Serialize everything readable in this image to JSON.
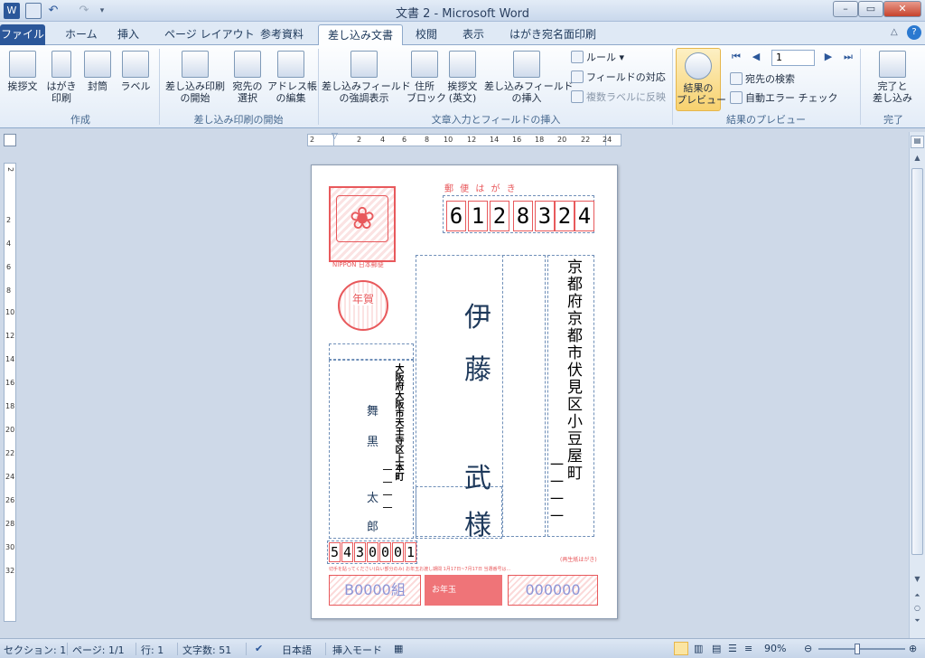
{
  "window": {
    "title": "文書 2 - Microsoft Word"
  },
  "tabs": [
    "ファイル",
    "ホーム",
    "挿入",
    "ページ レイアウト",
    "参考資料",
    "差し込み文書",
    "校閲",
    "表示",
    "はがき宛名面印刷"
  ],
  "ribbon": {
    "create": {
      "buttons": [
        "挨拶文",
        "はがき\n印刷",
        "封筒",
        "ラベル"
      ],
      "label": "作成"
    },
    "start": {
      "buttons": [
        "差し込み印刷\nの開始",
        "宛先の\n選択",
        "アドレス帳\nの編集"
      ],
      "label": "差し込み印刷の開始"
    },
    "write": {
      "buttons": [
        "差し込みフィールド\nの強調表示",
        "住所\nブロック",
        "挨拶文\n(英文)",
        "差し込みフィールド\nの挿入"
      ],
      "small": [
        "ルール",
        "フィールドの対応",
        "複数ラベルに反映"
      ],
      "label": "文章入力とフィールドの挿入"
    },
    "preview": {
      "button": "結果の\nプレビュー",
      "record": "1",
      "small": [
        "宛先の検索",
        "自動エラー チェック"
      ],
      "label": "結果のプレビュー"
    },
    "finish": {
      "button": "完了と\n差し込み",
      "label": "完了"
    }
  },
  "ruler_h": [
    "2",
    "2",
    "4",
    "6",
    "8",
    "10",
    "12",
    "14",
    "16",
    "18",
    "20",
    "22",
    "24"
  ],
  "ruler_v": [
    "2",
    "2",
    "4",
    "6",
    "8",
    "10",
    "12",
    "14",
    "16",
    "18",
    "20",
    "22",
    "24",
    "26",
    "28",
    "30",
    "32"
  ],
  "card": {
    "header": "郵 便 は が き",
    "zip": [
      "6",
      "1",
      "2",
      "8",
      "3",
      "2",
      "4"
    ],
    "recipient_address": "京都府京都市伏見区小豆屋町",
    "recipient_number": "一一一一",
    "recipient_name": [
      "伊",
      "藤",
      "武",
      "様"
    ],
    "sender_address": "大阪府大阪市天王寺区上本町",
    "sender_number": "一一一一",
    "sender_name": [
      "舞",
      "黒",
      "太",
      "郎"
    ],
    "sender_zip": [
      "5",
      "4",
      "3",
      "0",
      "0",
      "0",
      "1"
    ],
    "stamp_text": "NIPPON 日本郵便",
    "nenga": "年賀",
    "recycled": "(再生紙はがき)",
    "notice": "切手を貼ってください(白い部分のみ) お年玉お渡し期間 1月17日~7月17日 当選番号は...",
    "lottery_group": "B0000組",
    "lottery_number": "000000",
    "lottery_logo": "お年玉"
  },
  "status": {
    "section": "セクション: 1",
    "page": "ページ: 1/1",
    "line": "行: 1",
    "words": "文字数: 51",
    "lang": "日本語",
    "mode": "挿入モード",
    "zoom": "90%"
  },
  "colors": {
    "accent": "#2b579a",
    "card_red": "#e8595c"
  }
}
